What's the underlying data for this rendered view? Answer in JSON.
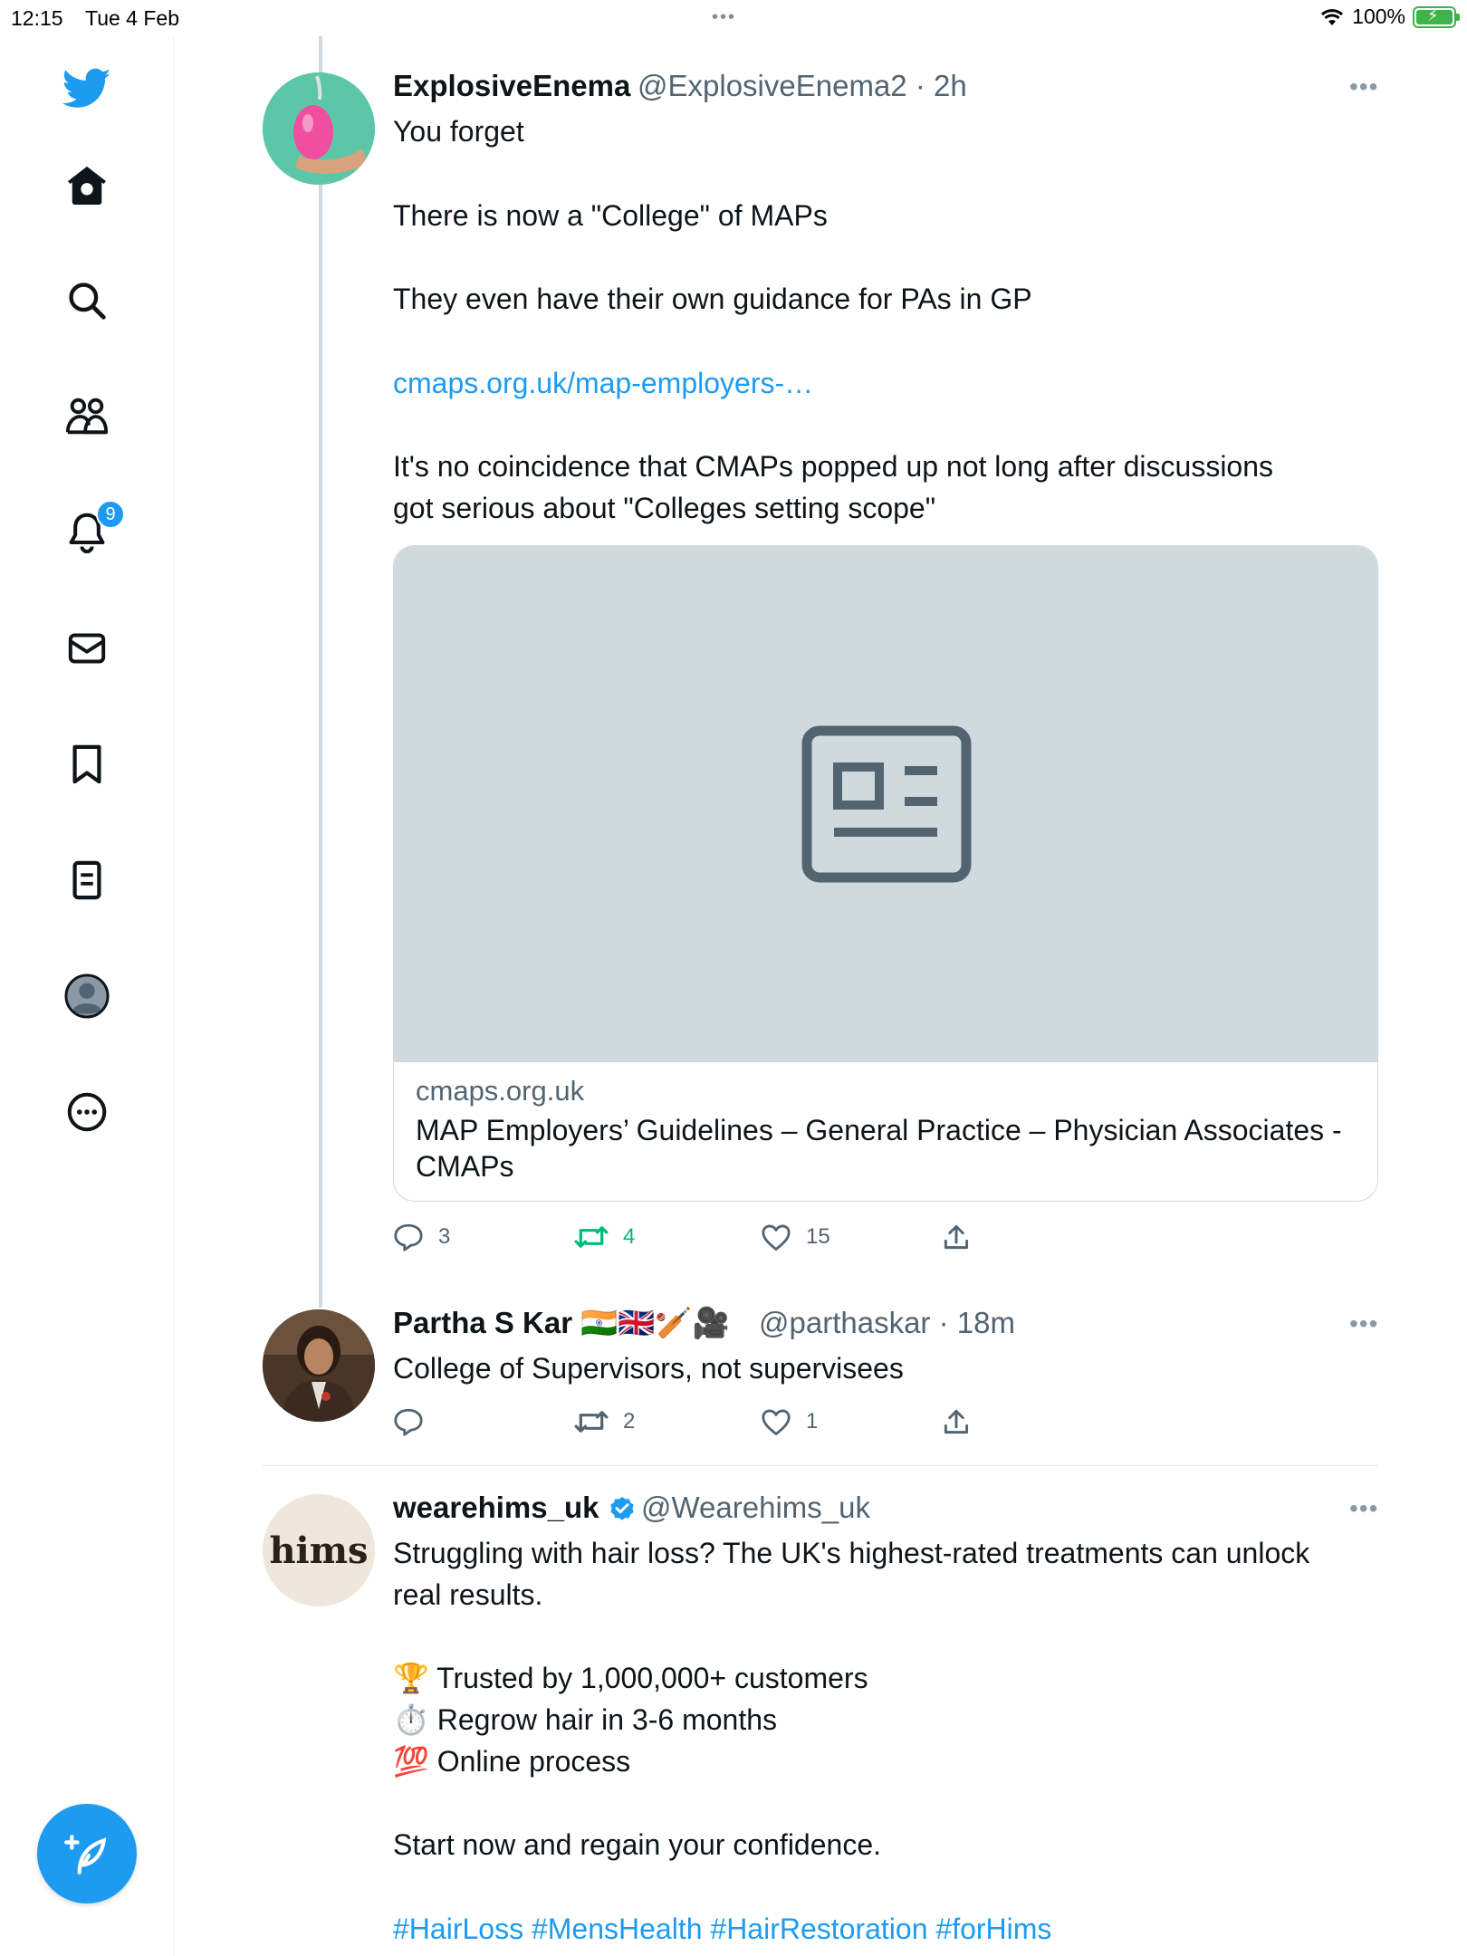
{
  "status": {
    "time": "12:15",
    "date": "Tue 4 Feb",
    "battery": "100%"
  },
  "sidebar": {
    "items": [
      {
        "name": "twitter-logo"
      },
      {
        "name": "home"
      },
      {
        "name": "explore"
      },
      {
        "name": "communities"
      },
      {
        "name": "notifications",
        "badge": "9"
      },
      {
        "name": "messages"
      },
      {
        "name": "bookmarks"
      },
      {
        "name": "lists"
      },
      {
        "name": "profile"
      },
      {
        "name": "more"
      }
    ],
    "compose_label": "Compose"
  },
  "tweets": [
    {
      "name": "ExplosiveEnema",
      "handle": "@ExplosiveEnema2 · 2h",
      "lines": [
        "You forget",
        "There is now a \"College\" of MAPs",
        "They even have their own guidance for PAs in GP",
        "cmaps.org.uk/map-employers-…",
        "It's no coincidence that CMAPs popped up not long after discussions",
        "got serious about \"Colleges setting scope\""
      ],
      "card": {
        "domain": "cmaps.org.uk",
        "title": "MAP Employers’ Guidelines – General Practice – Physician Associates - CMAPs"
      },
      "replies": "3",
      "retweets": "4",
      "likes": "15"
    },
    {
      "name": "Partha S Kar 🇮🇳🇬🇧🏏🎥",
      "handle": "@parthaskar · 18m",
      "lines": [
        "College of Supervisors, not supervisees"
      ],
      "replies": "",
      "retweets": "2",
      "likes": "1"
    },
    {
      "name": "wearehims_uk",
      "handle": "@Wearehims_uk",
      "logo_text": "hims",
      "lines": [
        "Struggling with hair loss? The UK's highest-rated treatments can unlock",
        "real results.",
        "🏆 Trusted by 1,000,000+ customers",
        "⏱️ Regrow hair in 3-6 months",
        "💯 Online process",
        "Start now and regain your confidence.",
        "#HairLoss #MensHealth #HairRestoration #forHims"
      ]
    }
  ],
  "colors": {
    "accent": "#1d9bf0",
    "retweet": "#00ba7c",
    "muted": "#536471",
    "card_bg": "#cfd9de"
  }
}
